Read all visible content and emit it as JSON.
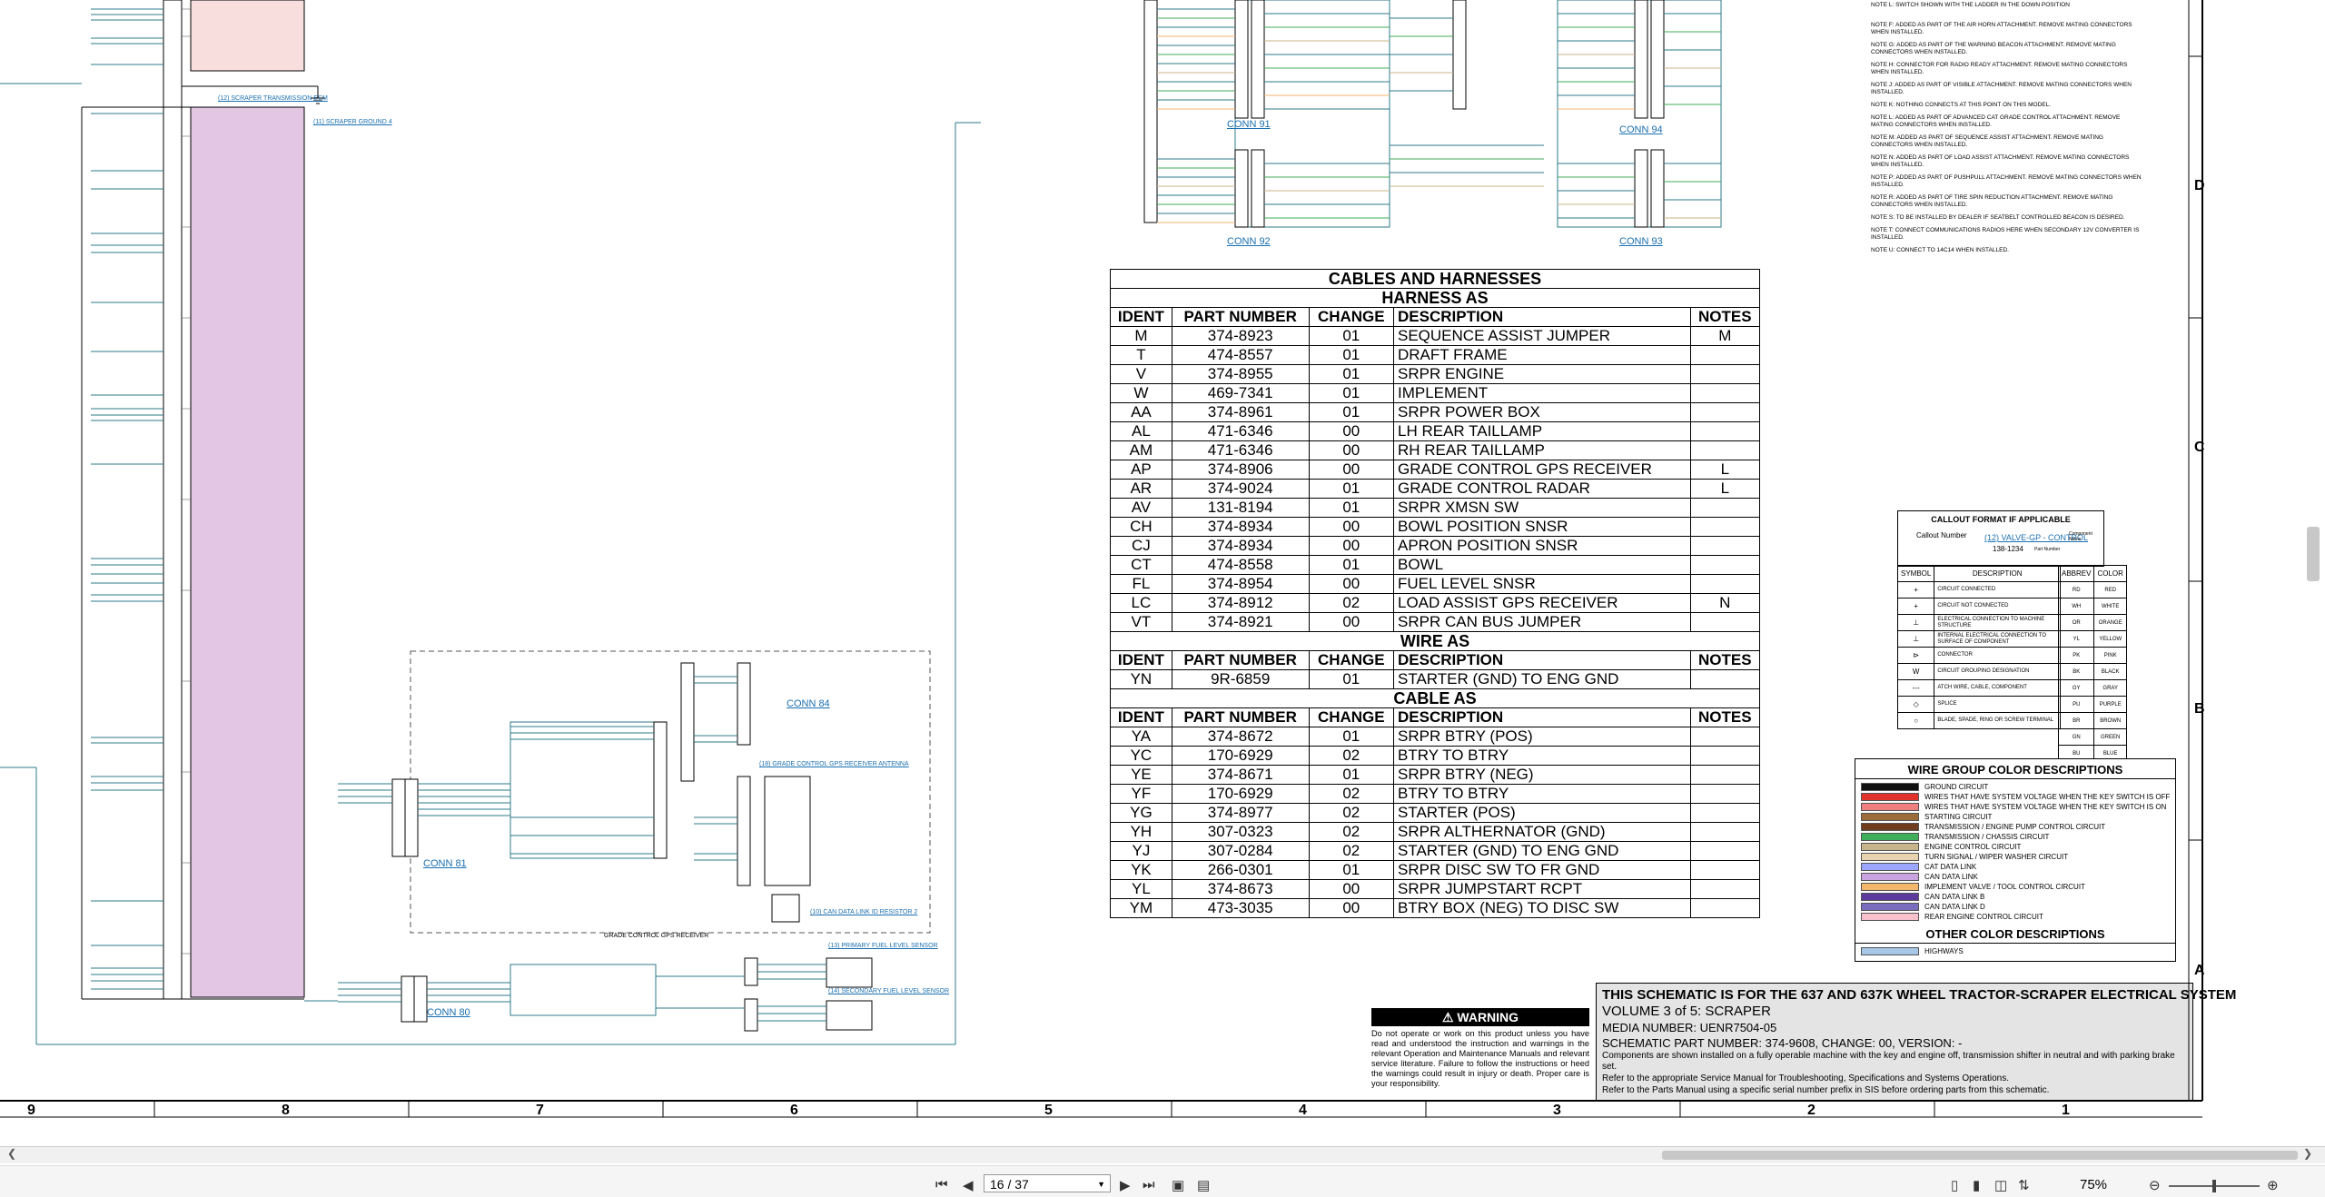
{
  "harness": {
    "title": "CABLES AND HARNESSES",
    "sections": [
      {
        "name": "HARNESS AS",
        "columns": [
          "IDENT",
          "PART NUMBER",
          "CHANGE",
          "DESCRIPTION",
          "NOTES"
        ],
        "rows": [
          [
            "M",
            "374-8923",
            "01",
            "SEQUENCE ASSIST JUMPER",
            "M"
          ],
          [
            "T",
            "474-8557",
            "01",
            "DRAFT FRAME",
            ""
          ],
          [
            "V",
            "374-8955",
            "01",
            "SRPR ENGINE",
            ""
          ],
          [
            "W",
            "469-7341",
            "01",
            "IMPLEMENT",
            ""
          ],
          [
            "AA",
            "374-8961",
            "01",
            "SRPR POWER BOX",
            ""
          ],
          [
            "AL",
            "471-6346",
            "00",
            "LH REAR TAILLAMP",
            ""
          ],
          [
            "AM",
            "471-6346",
            "00",
            "RH REAR TAILLAMP",
            ""
          ],
          [
            "AP",
            "374-8906",
            "00",
            "GRADE CONTROL GPS RECEIVER",
            "L"
          ],
          [
            "AR",
            "374-9024",
            "01",
            "GRADE CONTROL RADAR",
            "L"
          ],
          [
            "AV",
            "131-8194",
            "01",
            "SRPR XMSN SW",
            ""
          ],
          [
            "CH",
            "374-8934",
            "00",
            "BOWL POSITION SNSR",
            ""
          ],
          [
            "CJ",
            "374-8934",
            "00",
            "APRON POSITION SNSR",
            ""
          ],
          [
            "CT",
            "474-8558",
            "01",
            "BOWL",
            ""
          ],
          [
            "FL",
            "374-8954",
            "00",
            "FUEL LEVEL SNSR",
            ""
          ],
          [
            "LC",
            "374-8912",
            "02",
            "LOAD ASSIST GPS RECEIVER",
            "N"
          ],
          [
            "VT",
            "374-8921",
            "00",
            "SRPR CAN BUS JUMPER",
            ""
          ]
        ]
      },
      {
        "name": "WIRE AS",
        "columns": [
          "IDENT",
          "PART NUMBER",
          "CHANGE",
          "DESCRIPTION",
          "NOTES"
        ],
        "rows": [
          [
            "YN",
            "9R-6859",
            "01",
            "STARTER (GND) TO ENG GND",
            ""
          ]
        ]
      },
      {
        "name": "CABLE AS",
        "columns": [
          "IDENT",
          "PART NUMBER",
          "CHANGE",
          "DESCRIPTION",
          "NOTES"
        ],
        "rows": [
          [
            "YA",
            "374-8672",
            "01",
            "SRPR BTRY (POS)",
            ""
          ],
          [
            "YC",
            "170-6929",
            "02",
            "BTRY TO BTRY",
            ""
          ],
          [
            "YE",
            "374-8671",
            "01",
            "SRPR BTRY (NEG)",
            ""
          ],
          [
            "YF",
            "170-6929",
            "02",
            "BTRY TO BTRY",
            ""
          ],
          [
            "YG",
            "374-8977",
            "02",
            "STARTER (POS)",
            ""
          ],
          [
            "YH",
            "307-0323",
            "02",
            "SRPR ALTHERNATOR (GND)",
            ""
          ],
          [
            "YJ",
            "307-0284",
            "02",
            "STARTER (GND) TO ENG GND",
            ""
          ],
          [
            "YK",
            "266-0301",
            "01",
            "SRPR DISC SW TO FR GND",
            ""
          ],
          [
            "YL",
            "374-8673",
            "00",
            "SRPR JUMPSTART RCPT",
            ""
          ],
          [
            "YM",
            "473-3035",
            "00",
            "BTRY BOX (NEG) TO DISC SW",
            ""
          ]
        ]
      }
    ]
  },
  "connectors": {
    "conn91": "CONN 91",
    "conn92": "CONN 92",
    "conn93": "CONN 93",
    "conn94": "CONN 94",
    "conn84": "CONN 84",
    "conn81": "CONN 81",
    "conn80": "CONN 80"
  },
  "schematic_labels": {
    "grade_control": "GRADE CONTROL GPS RECEIVER",
    "transmission": "(12) SCRAPER TRANSMISSION ECM",
    "scraper_ground": "(11) SCRAPER GROUND 4",
    "gps_receiver": "(18) GRADE CONTROL GPS RECEIVER ANTENNA",
    "fuel_sensor_1": "(13) PRIMARY FUEL LEVEL SENSOR",
    "fuel_sensor_2": "(14) SECONDARY FUEL LEVEL SENSOR",
    "resistor": "(10) CAN DATA LINK ID RESISTOR 2"
  },
  "notes": [
    "NOTE L: SWITCH SHOWN WITH THE LADDER IN THE DOWN POSITION",
    "NOTE F: ADDED AS PART OF THE AIR HORN ATTACHMENT. REMOVE MATING CONNECTORS WHEN INSTALLED.",
    "NOTE G: ADDED AS PART OF THE WARNING BEACON ATTACHMENT. REMOVE MATING CONNECTORS WHEN INSTALLED.",
    "NOTE H: CONNECTOR FOR RADIO READY ATTACHMENT. REMOVE MATING CONNECTORS WHEN INSTALLED.",
    "NOTE J: ADDED AS PART OF VISIBLE ATTACHMENT. REMOVE MATING CONNECTORS WHEN INSTALLED.",
    "NOTE K: NOTHING CONNECTS AT THIS POINT ON THIS MODEL.",
    "NOTE L: ADDED AS PART OF ADVANCED CAT GRADE CONTROL ATTACHMENT. REMOVE MATING CONNECTORS WHEN INSTALLED.",
    "NOTE M: ADDED AS PART OF SEQUENCE ASSIST ATTACHMENT. REMOVE MATING CONNECTORS WHEN INSTALLED.",
    "NOTE N: ADDED AS PART OF LOAD ASSIST ATTACHMENT. REMOVE MATING CONNECTORS WHEN INSTALLED.",
    "NOTE P: ADDED AS PART OF PUSHPULL ATTACHMENT. REMOVE MATING CONNECTORS WHEN INSTALLED.",
    "NOTE R: ADDED AS PART OF TIRE SPIN REDUCTION ATTACHMENT. REMOVE MATING CONNECTORS WHEN INSTALLED.",
    "NOTE S: TO BE INSTALLED BY DEALER IF SEATBELT CONTROLLED BEACON IS DESIRED.",
    "NOTE T: CONNECT COMMUNICATIONS RADIOS HERE WHEN SECONDARY 12V CONVERTER IS INSTALLED.",
    "NOTE U: CONNECT TO 14C14 WHEN INSTALLED."
  ],
  "callout": {
    "title": "CALLOUT FORMAT IF APPLICABLE",
    "number_label": "Callout Number",
    "example_text": "(12) VALVE-GP - CONTROL",
    "example_part": "138-1234",
    "component_label": "Component Name",
    "part_label": "Part Number",
    "symbol_headers": [
      "SYMBOL",
      "DESCRIPTION"
    ],
    "symbols": [
      [
        "+",
        "CIRCUIT CONNECTED"
      ],
      [
        "+",
        "CIRCUIT NOT CONNECTED"
      ],
      [
        "⊥",
        "ELECTRICAL CONNECTION TO MACHINE STRUCTURE"
      ],
      [
        "⊥",
        "INTERNAL ELECTRICAL CONNECTION TO SURFACE OF COMPONENT"
      ],
      [
        "⊳",
        "CONNECTOR"
      ],
      [
        "W",
        "CIRCUIT GROUPING DESIGNATION"
      ],
      [
        "---",
        "ATCH WIRE, CABLE, COMPONENT"
      ],
      [
        "◇",
        "SPLICE"
      ],
      [
        "○",
        "BLADE, SPADE, RING OR SCREW TERMINAL"
      ]
    ],
    "color_headers": [
      "ABBREV",
      "COLOR"
    ],
    "colors": [
      [
        "RD",
        "RED"
      ],
      [
        "WH",
        "WHITE"
      ],
      [
        "OR",
        "ORANGE"
      ],
      [
        "YL",
        "YELLOW"
      ],
      [
        "PK",
        "PINK"
      ],
      [
        "BK",
        "BLACK"
      ],
      [
        "GY",
        "GRAY"
      ],
      [
        "PU",
        "PURPLE"
      ],
      [
        "BR",
        "BROWN"
      ],
      [
        "GN",
        "GREEN"
      ],
      [
        "BU",
        "BLUE"
      ]
    ]
  },
  "wire_groups": {
    "title": "WIRE GROUP COLOR DESCRIPTIONS",
    "items": [
      {
        "label": "GROUND CIRCUIT",
        "color": "#111111"
      },
      {
        "label": "WIRES THAT HAVE SYSTEM VOLTAGE WHEN THE KEY SWITCH IS OFF",
        "color": "#e0312b"
      },
      {
        "label": "WIRES THAT HAVE SYSTEM VOLTAGE WHEN THE KEY SWITCH IS ON",
        "color": "#f08080"
      },
      {
        "label": "STARTING CIRCUIT",
        "color": "#9b6b3a"
      },
      {
        "label": "TRANSMISSION / ENGINE PUMP CONTROL CIRCUIT",
        "color": "#6f3d1d"
      },
      {
        "label": "TRANSMISSION / CHASSIS CIRCUIT",
        "color": "#3fae5a"
      },
      {
        "label": "ENGINE CONTROL CIRCUIT",
        "color": "#c8b48a"
      },
      {
        "label": "TURN SIGNAL / WIPER WASHER CIRCUIT",
        "color": "#e8d2b0"
      },
      {
        "label": "CAT DATA LINK",
        "color": "#9aa6ff"
      },
      {
        "label": "CAN DATA LINK",
        "color": "#c9a2e0"
      },
      {
        "label": "IMPLEMENT VALVE / TOOL CONTROL CIRCUIT",
        "color": "#f2b76b"
      },
      {
        "label": "CAN DATA LINK B",
        "color": "#5b3b9e"
      },
      {
        "label": "CAN DATA LINK D",
        "color": "#7a6dbe"
      },
      {
        "label": "REAR ENGINE CONTROL CIRCUIT",
        "color": "#f6c0cd"
      }
    ],
    "other_title": "OTHER COLOR DESCRIPTIONS",
    "other_items": [
      {
        "label": "HIGHWAYS",
        "color": "#a7c7e7"
      }
    ]
  },
  "warning": {
    "title": "WARNING",
    "body": "Do not operate or work on this product unless you have read and understood the instruction and warnings in the relevant Operation and Maintenance Manuals and relevant service literature. Failure to follow the instructions or heed the warnings could result in injury or death. Proper care is your responsibility."
  },
  "title_block": {
    "line1": "THIS SCHEMATIC IS FOR THE 637 AND 637K WHEEL TRACTOR-SCRAPER ELECTRICAL SYSTEM",
    "line2": "VOLUME 3 of 5: SCRAPER",
    "line3": "MEDIA NUMBER: UENR7504-05",
    "line4": "SCHEMATIC PART NUMBER: 374-9608, CHANGE: 00, VERSION: -",
    "line5": "Components are shown installed on a fully operable machine with the key and engine off, transmission shifter in neutral and with parking brake set.",
    "line6": "Refer to the appropriate Service Manual for Troubleshooting, Specifications and Systems Operations.",
    "line7": "Refer to the Parts Manual using a specific serial number prefix in SIS before ordering parts from this schematic."
  },
  "grid": {
    "columns": [
      "9",
      "8",
      "7",
      "6",
      "5",
      "4",
      "3",
      "2",
      "1"
    ],
    "rows": [
      "D",
      "C",
      "B",
      "A"
    ]
  },
  "pager": {
    "page": "16 / 37",
    "zoom": "75%"
  }
}
